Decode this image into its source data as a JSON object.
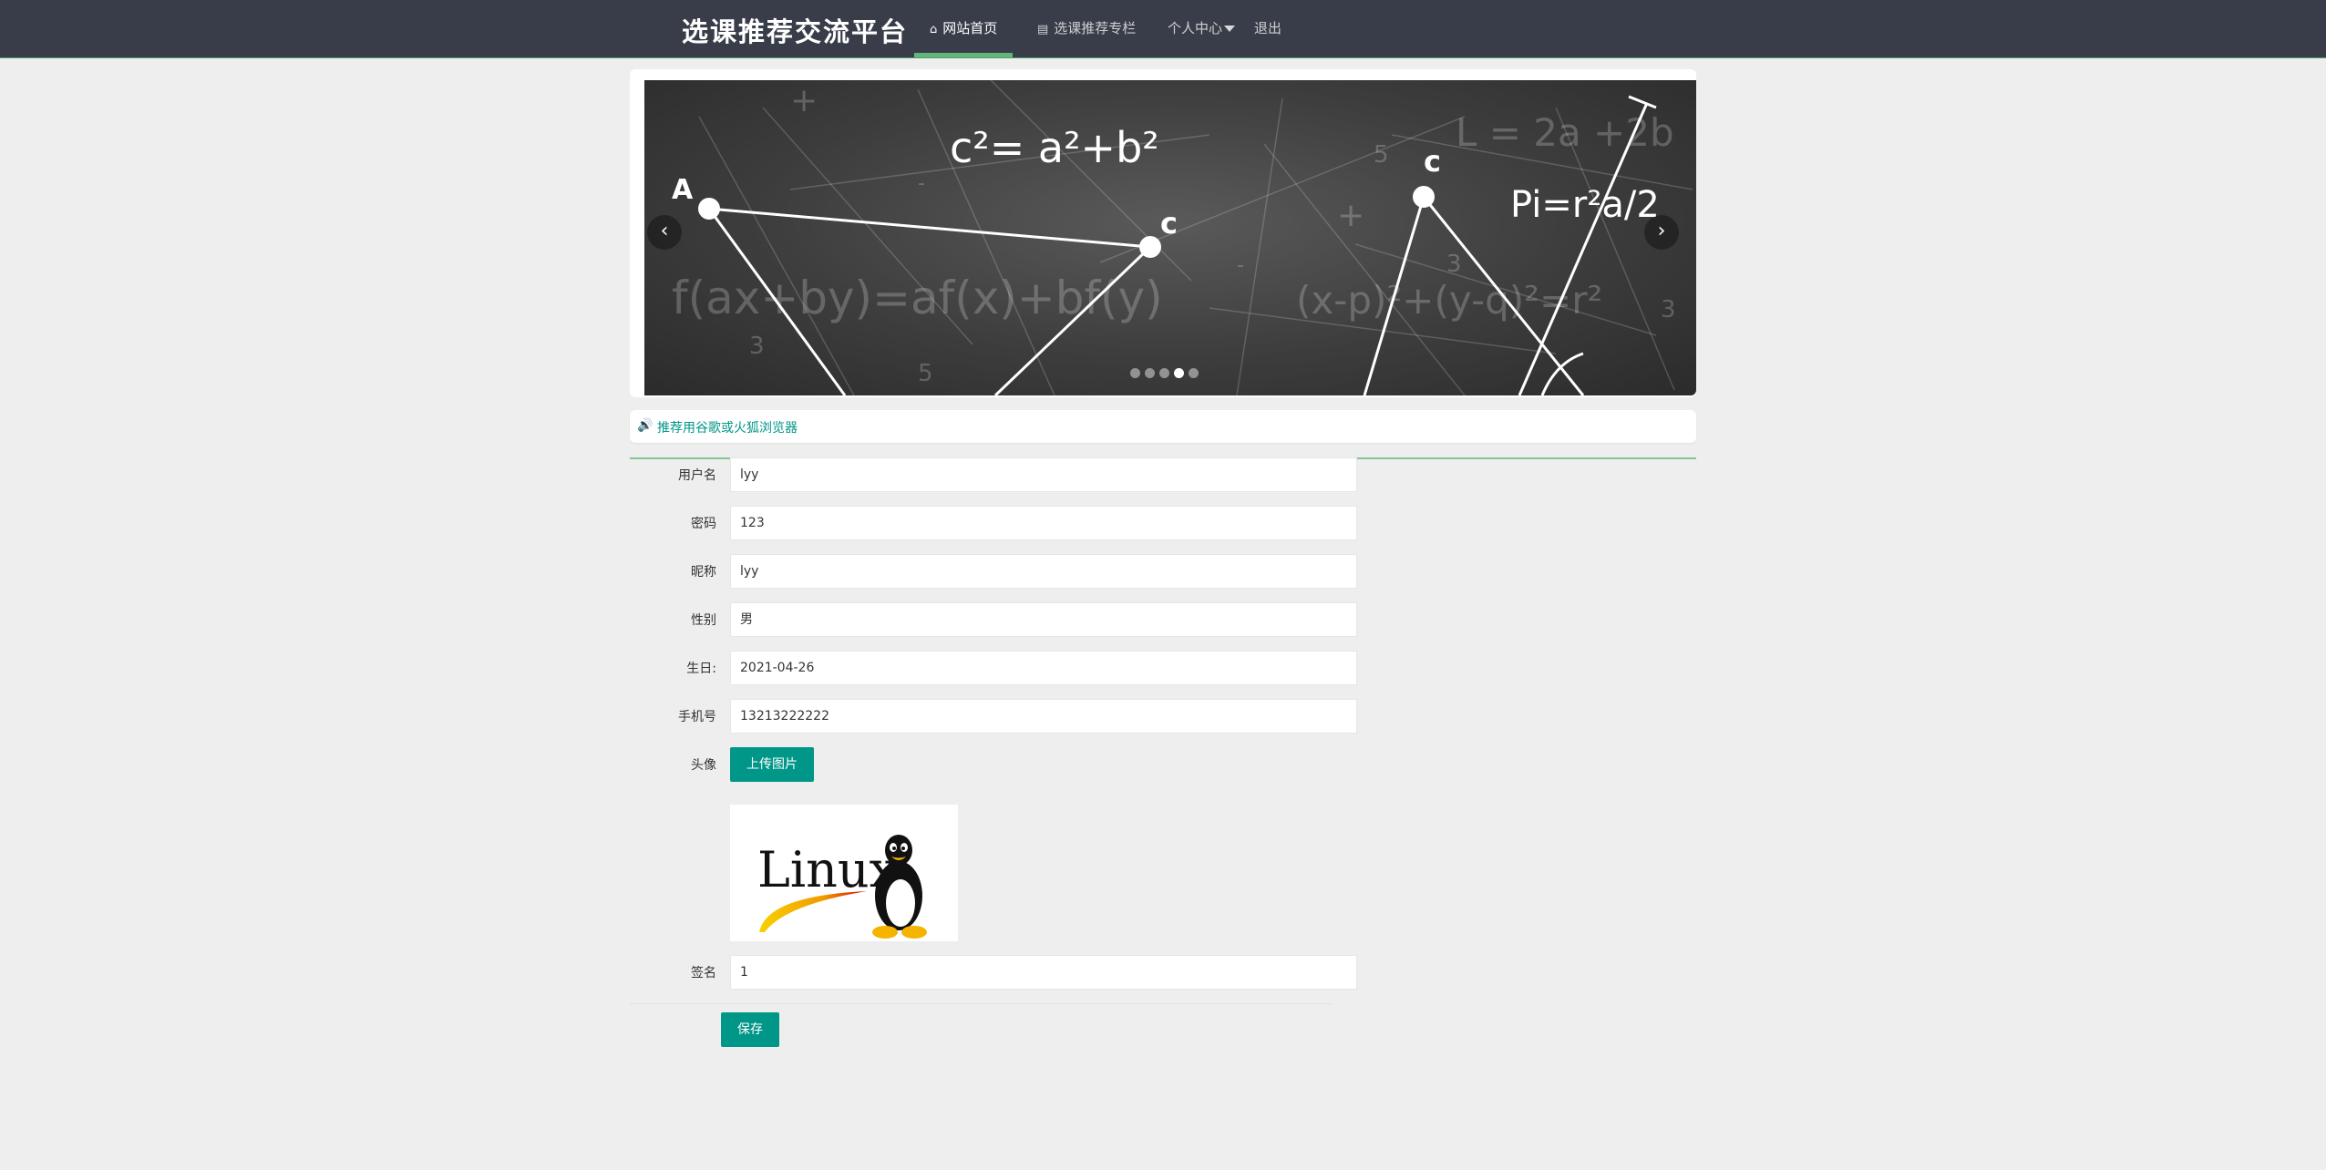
{
  "header": {
    "logo": "选课推荐交流平台",
    "nav": [
      {
        "label": "网站首页",
        "icon": "home-icon"
      },
      {
        "label": "选课推荐专栏",
        "icon": "file-icon"
      },
      {
        "label": "个人中心",
        "icon": "caret-down-icon"
      },
      {
        "label": "退出"
      }
    ]
  },
  "banner": {
    "slides": 5,
    "active_slide": 4,
    "prev_label": "‹",
    "next_label": "›",
    "art": {
      "formula1": "c²= a²+b²",
      "formula2": "L = 2a +2b",
      "formula3": "Pi=r²a/2",
      "formula4": "f(ax+by)=af(x)+bf(y)",
      "formula5": "(x-p)²+(y-q)²=r²",
      "labelA": "A",
      "labelC1": "c",
      "labelC2": "c"
    }
  },
  "notice": {
    "text": "推荐用谷歌或火狐浏览器"
  },
  "form": {
    "fields": [
      {
        "label": "用户名",
        "value": "lyy"
      },
      {
        "label": "密码",
        "value": "123"
      },
      {
        "label": "昵称",
        "value": "lyy"
      },
      {
        "label": "性别",
        "value": "男"
      },
      {
        "label": "生日:",
        "value": "2021-04-26"
      },
      {
        "label": "手机号",
        "value": "13213222222"
      }
    ],
    "avatar_label": "头像",
    "upload_label": "上传图片",
    "avatar_image_text": "Linux",
    "signature_label": "签名",
    "signature_value": "1",
    "save_label": "保存"
  },
  "colors": {
    "header_bg": "#393d49",
    "accent": "#009688",
    "nav_active_bar": "#5fb878",
    "page_bg": "#eeeeee"
  }
}
